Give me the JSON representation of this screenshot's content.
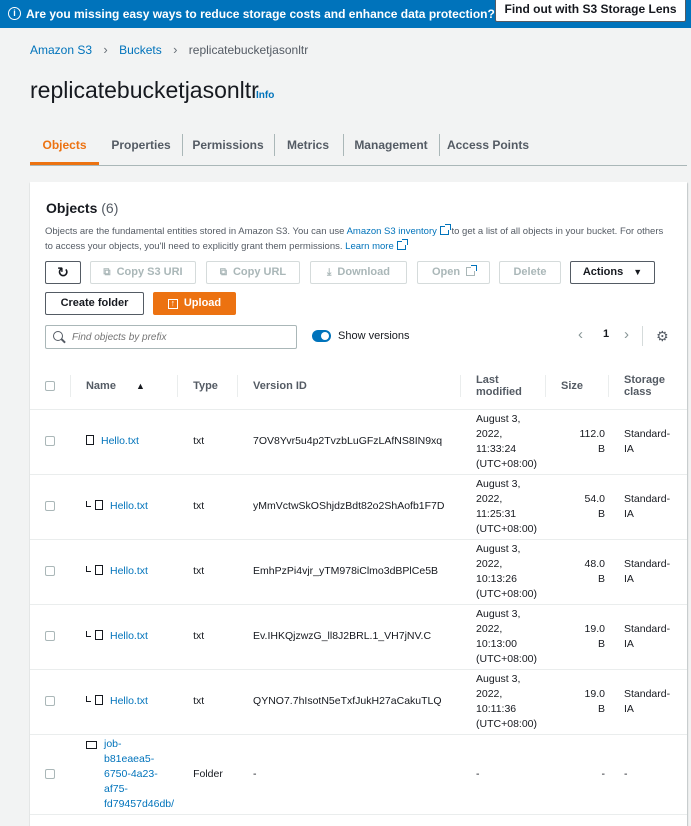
{
  "banner": {
    "text": "Are you missing easy ways to reduce storage costs and enhance data protection?",
    "button": "Find out with S3 Storage Lens"
  },
  "breadcrumb": [
    "Amazon S3",
    "Buckets",
    "replicatebucketjasonltr"
  ],
  "page": {
    "title": "replicatebucketjasonltr",
    "info": "Info"
  },
  "tabs": [
    "Objects",
    "Properties",
    "Permissions",
    "Metrics",
    "Management",
    "Access Points"
  ],
  "objects": {
    "title": "Objects",
    "count": "(6)",
    "desc_1": "Objects are the fundamental entities stored in Amazon S3. You can use ",
    "desc_link_1": "Amazon S3 inventory",
    "desc_2": " to get a list of all objects in your bucket. For others to access your objects, you'll need to explicitly grant them permissions. ",
    "desc_link_2": "Learn more",
    "buttons": {
      "refresh": "↻",
      "copy_uri": "Copy S3 URI",
      "copy_url": "Copy URL",
      "download": "Download",
      "open": "Open",
      "delete": "Delete",
      "actions": "Actions",
      "create_folder": "Create folder",
      "upload": "Upload"
    },
    "search_placeholder": "Find objects by prefix",
    "show_versions": "Show versions",
    "page": "1"
  },
  "table": {
    "headers": [
      "Name",
      "Type",
      "Version ID",
      "Last modified",
      "Size",
      "Storage class"
    ],
    "rows": [
      {
        "name": "Hello.txt",
        "type": "txt",
        "version": "7OV8Yvr5u4p2TvzbLuGFzLAfNS8IN9xq",
        "modified": [
          "August 3,",
          "2022,",
          "11:33:24",
          "(UTC+08:00)"
        ],
        "size": [
          "112.0",
          "B"
        ],
        "class": [
          "Standard-",
          "IA"
        ]
      },
      {
        "name": "Hello.txt",
        "type": "txt",
        "version": "yMmVctwSkOShjdzBdt82o2ShAofb1F7D",
        "modified": [
          "August 3,",
          "2022,",
          "11:25:31",
          "(UTC+08:00)"
        ],
        "size": [
          "54.0",
          "B"
        ],
        "class": [
          "Standard-",
          "IA"
        ]
      },
      {
        "name": "Hello.txt",
        "type": "txt",
        "version": "EmhPzPi4vjr_yTM978iClmo3dBPlCe5B",
        "modified": [
          "August 3,",
          "2022,",
          "10:13:26",
          "(UTC+08:00)"
        ],
        "size": [
          "48.0",
          "B"
        ],
        "class": [
          "Standard-",
          "IA"
        ]
      },
      {
        "name": "Hello.txt",
        "type": "txt",
        "version": "Ev.IHKQjzwzG_ll8J2BRL.1_VH7jNV.C",
        "modified": [
          "August 3,",
          "2022,",
          "10:13:00",
          "(UTC+08:00)"
        ],
        "size": [
          "19.0",
          "B"
        ],
        "class": [
          "Standard-",
          "IA"
        ]
      },
      {
        "name": "Hello.txt",
        "type": "txt",
        "version": "QYNO7.7hIsotN5eTxfJukH27aCakuTLQ",
        "modified": [
          "August 3,",
          "2022,",
          "10:11:36",
          "(UTC+08:00)"
        ],
        "size": [
          "19.0",
          "B"
        ],
        "class": [
          "Standard-",
          "IA"
        ]
      },
      {
        "name": [
          "job-",
          "b81eaea5-",
          "6750-4a23-",
          "af75-",
          "fd79457d46db/"
        ],
        "type": "Folder",
        "version": "-",
        "modified": [
          "-"
        ],
        "size": [
          "-"
        ],
        "class": [
          "-"
        ]
      }
    ]
  },
  "colors": {
    "accent": "#ec7211",
    "link": "#0073bb",
    "banner": "#0073bb"
  }
}
